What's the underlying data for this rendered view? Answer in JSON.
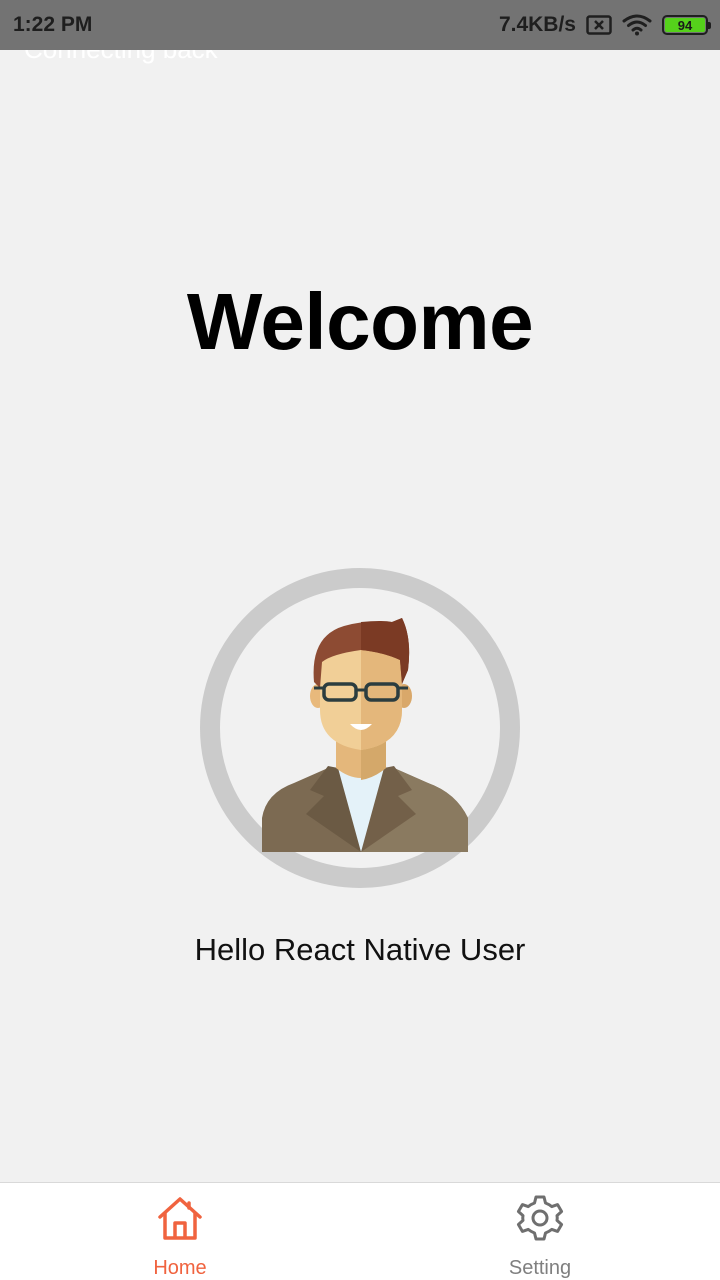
{
  "status_bar": {
    "time": "1:22 PM",
    "network_speed": "7.4KB/s",
    "battery_level": "94",
    "icons": [
      "sim-blocked-icon",
      "wifi-icon",
      "battery-icon"
    ]
  },
  "toast": {
    "text": "Connecting back"
  },
  "main": {
    "title": "Welcome",
    "avatar": {
      "icon": "user-avatar-icon"
    },
    "greeting": "Hello React Native User"
  },
  "tabbar": {
    "tabs": [
      {
        "label": "Home",
        "icon": "home-icon",
        "active": true
      },
      {
        "label": "Setting",
        "icon": "gear-icon",
        "active": false
      }
    ]
  },
  "colors": {
    "accent": "#f0633f",
    "status_bar": "#737373",
    "background": "#f1f1f1",
    "ring": "#cbcbcb",
    "battery_fill": "#55d11b"
  }
}
